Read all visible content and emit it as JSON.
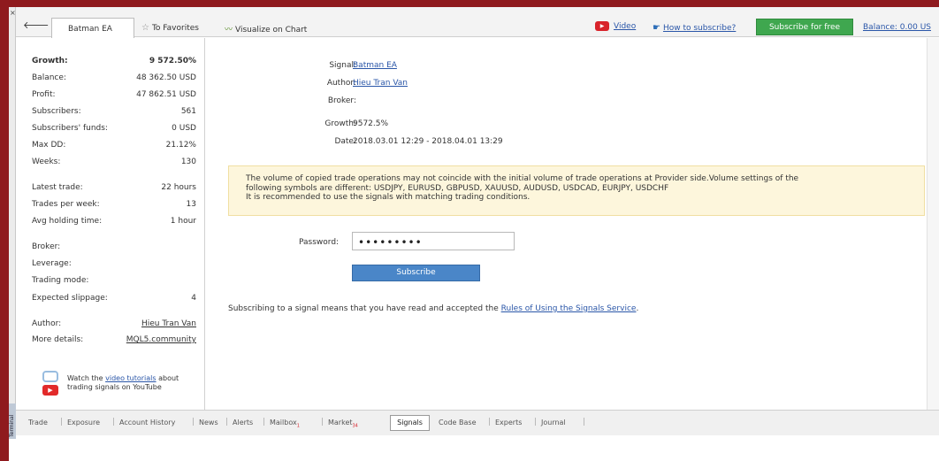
{
  "toolbar": {
    "back_icon": "arrow-left-icon",
    "tab_active": "Batman EA",
    "favorites": "To Favorites",
    "visualize": "Visualize on Chart",
    "video": "Video",
    "how_to_subscribe": "How to subscribe?",
    "subscribe_free": "Subscribe for free",
    "balance": "Balance: 0.00 US"
  },
  "sidebar": {
    "stats": [
      {
        "label": "Growth:",
        "value": "9 572.50%"
      },
      {
        "label": "Balance:",
        "value": "48 362.50 USD"
      },
      {
        "label": "Profit:",
        "value": "47 862.51 USD"
      },
      {
        "label": "Subscribers:",
        "value": "561"
      },
      {
        "label": "Subscribers' funds:",
        "value": "0 USD"
      },
      {
        "label": "Max DD:",
        "value": "21.12%"
      },
      {
        "label": "Weeks:",
        "value": "130"
      },
      {
        "label": "Latest trade:",
        "value": "22 hours"
      },
      {
        "label": "Trades per week:",
        "value": "13"
      },
      {
        "label": "Avg holding time:",
        "value": "1 hour"
      },
      {
        "label": "Broker:",
        "value": ""
      },
      {
        "label": "Leverage:",
        "value": ""
      },
      {
        "label": "Trading mode:",
        "value": ""
      },
      {
        "label": "Expected slippage:",
        "value": "4"
      },
      {
        "label": "Author:",
        "value": "Hieu Tran Van"
      },
      {
        "label": "More details:",
        "value": "MQL5.community"
      }
    ],
    "video_text_1": "Watch the ",
    "video_link": "video tutorials",
    "video_text_2": " about trading signals on YouTube"
  },
  "main": {
    "signal_label": "Signal:",
    "signal_value": "Batman EA",
    "author_label": "Author:",
    "author_value": "Hieu Tran Van",
    "broker_label": "Broker:",
    "growth_label": "Growth:",
    "growth_value": "9572.5%",
    "date_label": "Date:",
    "date_value": "2018.03.01 12:29 - 2018.04.01 13:29",
    "warning_line1": "The volume of copied trade operations may not coincide with the initial volume of trade operations at Provider side.Volume settings of the",
    "warning_line2": "following symbols are different: USDJPY, EURUSD, GBPUSD, XAUUSD, AUDUSD, USDCAD, EURJPY, USDCHF",
    "warning_line3": "It is recommended to use the signals with matching trading conditions.",
    "password_label": "Password:",
    "password_value": "•••••••••",
    "subscribe_button": "Subscribe",
    "rules_text": "Subscribing to a signal means that you have read and accepted the ",
    "rules_link": "Rules of Using the Signals Service",
    "rules_end": "."
  },
  "bottom_tabs": {
    "trade": "Trade",
    "exposure": "Exposure",
    "account_history": "Account History",
    "news": "News",
    "alerts": "Alerts",
    "mailbox": "Mailbox",
    "mailbox_badge": "1",
    "market": "Market",
    "market_badge": "34",
    "signals": "Signals",
    "code_base": "Code Base",
    "experts": "Experts",
    "journal": "Journal"
  },
  "strip_label": "Terminal"
}
